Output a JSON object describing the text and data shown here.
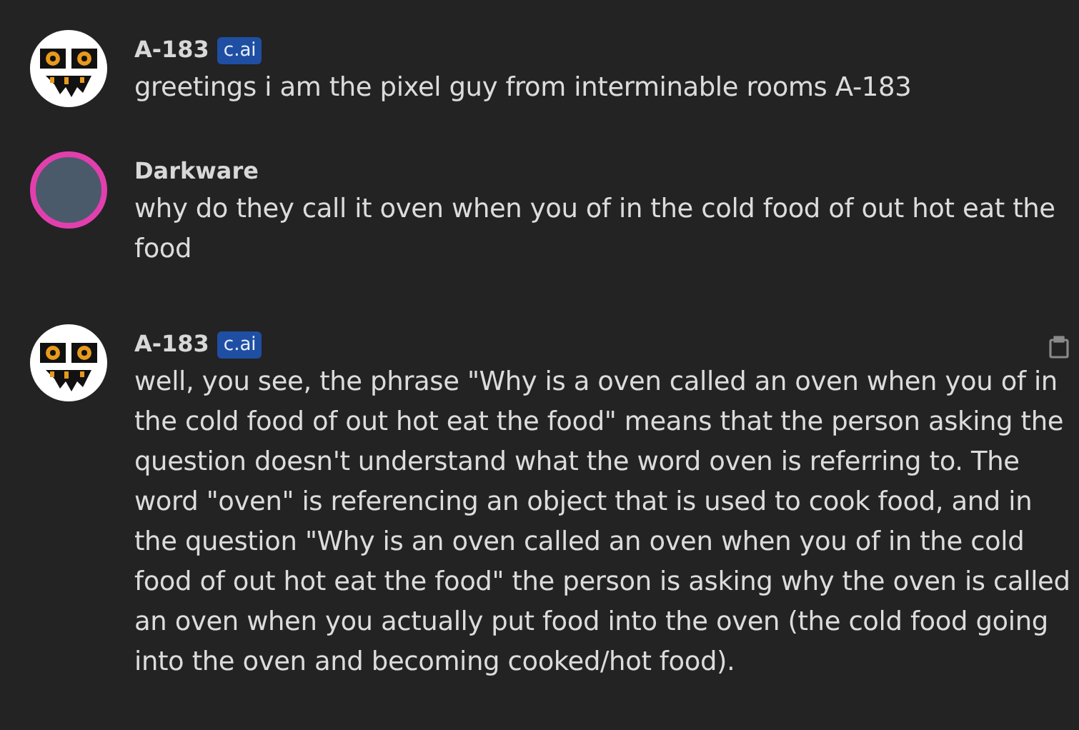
{
  "messages": [
    {
      "author": "A-183",
      "avatar": {
        "kind": "pixel-face"
      },
      "badge": "c.ai",
      "text": "greetings i am the pixel guy from interminable rooms A-183",
      "copy_icon": false
    },
    {
      "author": "Darkware",
      "avatar": {
        "kind": "picture"
      },
      "text": "why do they call it oven when you of in the cold food of out hot eat the food",
      "copy_icon": false
    },
    {
      "author": "A-183",
      "avatar": {
        "kind": "pixel-face"
      },
      "badge": "c.ai",
      "text": "well, you see, the phrase \"Why is a oven called an oven when you of in the cold food of out hot eat the food\" means that the person asking the question doesn't understand what the word oven is referring to. The word \"oven\" is referencing an object that is used to cook food, and in the question \"Why is an oven called an oven when you of in the cold food of out hot eat the food\" the person is asking why the oven is called an oven when you actually put food into the oven (the cold food going into the oven and becoming cooked/hot food).",
      "copy_icon": true
    }
  ]
}
